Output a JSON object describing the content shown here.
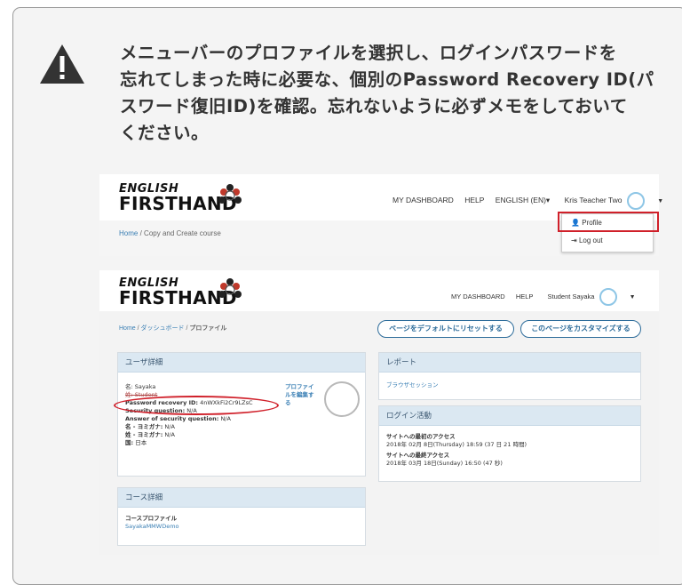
{
  "note": {
    "line1": "メニューバーのプロファイルを選択し、ログインパスワードを",
    "line2": "忘れてしまった時に必要な、個別のPassword Recovery ID(パ",
    "line3": "スワード復旧ID)を確認。忘れないように必ずメモをしておいて",
    "line4": "ください。"
  },
  "icons": {
    "warning": "warning-triangle-icon",
    "user": "user-icon",
    "logout": "logout-icon"
  },
  "colors": {
    "highlight": "#d0202a",
    "link": "#3a7fb4",
    "panel_header": "#dbe8f2"
  },
  "logo": {
    "line1": "ENGLISH",
    "line2": "FIRSTHAND"
  },
  "shot1": {
    "nav": {
      "dashboard": "MY DASHBOARD",
      "help": "HELP",
      "language": "ENGLISH (EN)▾",
      "user": "Kris Teacher Two"
    },
    "breadcrumb": {
      "home": "Home",
      "sep": "/",
      "current": "Copy and Create course"
    },
    "dropdown": {
      "profile": "Profile",
      "logout": "Log out"
    }
  },
  "shot2": {
    "nav": {
      "dashboard": "MY DASHBOARD",
      "help": "HELP",
      "user": "Student Sayaka"
    },
    "breadcrumb": {
      "home": "Home",
      "dashboard": "ダッシュボード",
      "current": "プロファイル",
      "sep": "/"
    },
    "buttons": {
      "reset": "ページをデフォルトにリセットする",
      "customize": "このページをカスタマイズする"
    },
    "user_details": {
      "title": "ユーザ詳細",
      "name": "名: Sayaka",
      "group": "姓: Student",
      "recovery_label": "Password recovery ID:",
      "recovery_value": "4nWXkFi2Cr9LZsC",
      "security_q": "Security question:",
      "security_q_val": "N/A",
      "answer_q": "Answer of security question:",
      "answer_q_val": "N/A",
      "kana_first": "名 - ヨミガナ:",
      "kana_first_val": "N/A",
      "kana_last": "姓 - ヨミガナ:",
      "kana_last_val": "N/A",
      "country": "国:",
      "country_val": "日本",
      "edit_link_1": "プロファイ",
      "edit_link_2": "ルを編集す",
      "edit_link_3": "る"
    },
    "course_details": {
      "title": "コース詳細",
      "label": "コースプロファイル",
      "course": "SayakaMMWDemo"
    },
    "report": {
      "title": "レポート",
      "browser_sessions": "ブラウザセッション"
    },
    "login_activity": {
      "title": "ログイン活動",
      "first_label": "サイトへの最初のアクセス",
      "first_value": "2018年 02月 8日(Thursday) 18:59  (37 日 21 時間)",
      "last_label": "サイトへの最終アクセス",
      "last_value": "2018年 03月 18日(Sunday) 16:50  (47 秒)"
    }
  }
}
